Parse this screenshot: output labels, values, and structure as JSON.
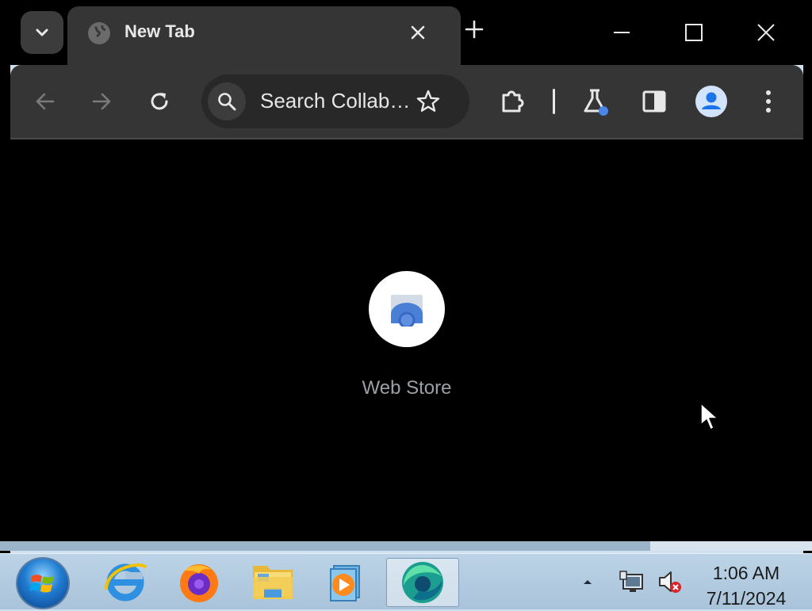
{
  "browser": {
    "tab": {
      "title": "New Tab"
    },
    "omnibox": {
      "text": "Search Collab…"
    }
  },
  "content": {
    "shortcut": {
      "label": "Web Store"
    }
  },
  "taskbar": {
    "apps": [
      {
        "icon": "internet-explorer-icon"
      },
      {
        "icon": "firefox-icon"
      },
      {
        "icon": "file-explorer-icon"
      },
      {
        "icon": "media-player-icon"
      },
      {
        "icon": "browser-icon"
      }
    ],
    "clock": {
      "time": "1:06 AM",
      "date": "7/11/2024"
    }
  },
  "colors": {
    "toolbar": "#353535",
    "tab_strip": "#000000",
    "content_bg": "#000000",
    "shortcut_label": "#9aa0a6",
    "profile_accent": "#1a73e8"
  }
}
